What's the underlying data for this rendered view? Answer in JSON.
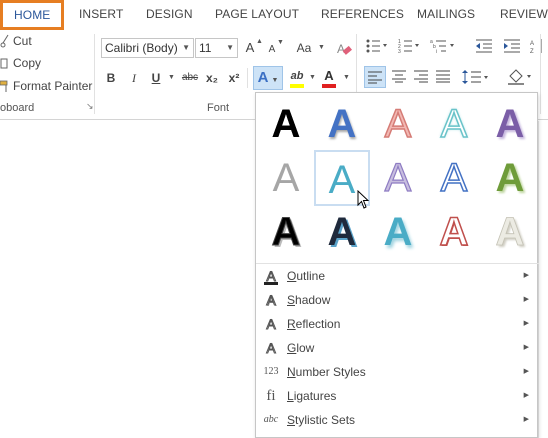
{
  "tabs": [
    "HOME",
    "INSERT",
    "DESIGN",
    "PAGE LAYOUT",
    "REFERENCES",
    "MAILINGS",
    "REVIEW"
  ],
  "clipboard": {
    "cut": "Cut",
    "copy": "Copy",
    "format_painter": "Format Painter",
    "group_label": "oboard"
  },
  "font": {
    "name": "Calibri (Body)",
    "size": "11",
    "group_label": "Font",
    "grow": "A",
    "shrink": "A",
    "change_case": "Aa",
    "bold": "B",
    "italic": "I",
    "underline": "U",
    "strike": "abc",
    "subscript": "x₂",
    "superscript": "x²",
    "effects_btn": "A",
    "highlight": "ab",
    "font_color": "A"
  },
  "gallery": {
    "effects": [
      "A",
      "A",
      "A",
      "A",
      "A",
      "A",
      "A",
      "A",
      "A",
      "A",
      "A",
      "A",
      "A",
      "A",
      "A"
    ],
    "menu": [
      {
        "label": "Outline",
        "icon": "outline-icon"
      },
      {
        "label": "Shadow",
        "icon": "shadow-icon"
      },
      {
        "label": "Reflection",
        "icon": "reflection-icon"
      },
      {
        "label": "Glow",
        "icon": "glow-icon"
      },
      {
        "label": "Number Styles",
        "icon": "number-styles-icon"
      },
      {
        "label": "Ligatures",
        "icon": "ligatures-icon"
      },
      {
        "label": "Stylistic Sets",
        "icon": "stylistic-sets-icon"
      }
    ],
    "menu_icons": [
      "A",
      "A",
      "A",
      "A",
      "123",
      "fi",
      "abc"
    ]
  },
  "colors": {
    "accent_tab": "#2b579a",
    "tab_highlight_border": "#e67e22",
    "font_color_bar": "#e02020",
    "highlight_bar": "#ffff00"
  }
}
